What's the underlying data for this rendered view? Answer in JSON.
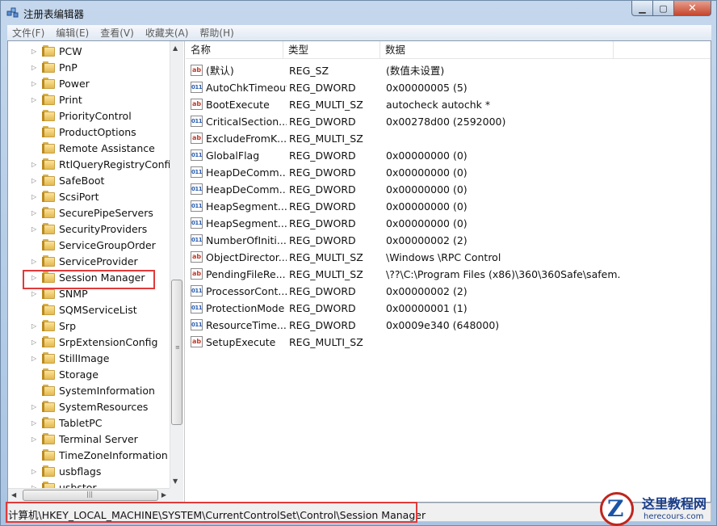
{
  "window": {
    "title": "注册表编辑器"
  },
  "menu": [
    "文件(F)",
    "编辑(E)",
    "查看(V)",
    "收藏夹(A)",
    "帮助(H)"
  ],
  "tree": {
    "items": [
      {
        "label": "PCW",
        "expandable": true
      },
      {
        "label": "PnP",
        "expandable": true
      },
      {
        "label": "Power",
        "expandable": true
      },
      {
        "label": "Print",
        "expandable": true
      },
      {
        "label": "PriorityControl",
        "expandable": false
      },
      {
        "label": "ProductOptions",
        "expandable": false
      },
      {
        "label": "Remote Assistance",
        "expandable": false
      },
      {
        "label": "RtlQueryRegistryConfig",
        "expandable": true
      },
      {
        "label": "SafeBoot",
        "expandable": true
      },
      {
        "label": "ScsiPort",
        "expandable": true
      },
      {
        "label": "SecurePipeServers",
        "expandable": true
      },
      {
        "label": "SecurityProviders",
        "expandable": true
      },
      {
        "label": "ServiceGroupOrder",
        "expandable": false
      },
      {
        "label": "ServiceProvider",
        "expandable": true
      },
      {
        "label": "Session Manager",
        "expandable": true,
        "selected": true
      },
      {
        "label": "SNMP",
        "expandable": true
      },
      {
        "label": "SQMServiceList",
        "expandable": false
      },
      {
        "label": "Srp",
        "expandable": true
      },
      {
        "label": "SrpExtensionConfig",
        "expandable": true
      },
      {
        "label": "StillImage",
        "expandable": true
      },
      {
        "label": "Storage",
        "expandable": false
      },
      {
        "label": "SystemInformation",
        "expandable": false
      },
      {
        "label": "SystemResources",
        "expandable": true
      },
      {
        "label": "TabletPC",
        "expandable": true
      },
      {
        "label": "Terminal Server",
        "expandable": true
      },
      {
        "label": "TimeZoneInformation",
        "expandable": false
      },
      {
        "label": "usbflags",
        "expandable": true
      },
      {
        "label": "usbstor",
        "expandable": true
      }
    ]
  },
  "list": {
    "headers": [
      "名称",
      "类型",
      "数据"
    ],
    "rows": [
      {
        "icon": "ab",
        "name": "(默认)",
        "type": "REG_SZ",
        "data": "(数值未设置)"
      },
      {
        "icon": "bin",
        "name": "AutoChkTimeout",
        "type": "REG_DWORD",
        "data": "0x00000005 (5)"
      },
      {
        "icon": "ab",
        "name": "BootExecute",
        "type": "REG_MULTI_SZ",
        "data": "autocheck autochk *"
      },
      {
        "icon": "bin",
        "name": "CriticalSection...",
        "type": "REG_DWORD",
        "data": "0x00278d00 (2592000)"
      },
      {
        "icon": "ab",
        "name": "ExcludeFromK...",
        "type": "REG_MULTI_SZ",
        "data": ""
      },
      {
        "icon": "bin",
        "name": "GlobalFlag",
        "type": "REG_DWORD",
        "data": "0x00000000 (0)"
      },
      {
        "icon": "bin",
        "name": "HeapDeComm...",
        "type": "REG_DWORD",
        "data": "0x00000000 (0)"
      },
      {
        "icon": "bin",
        "name": "HeapDeComm...",
        "type": "REG_DWORD",
        "data": "0x00000000 (0)"
      },
      {
        "icon": "bin",
        "name": "HeapSegment...",
        "type": "REG_DWORD",
        "data": "0x00000000 (0)"
      },
      {
        "icon": "bin",
        "name": "HeapSegment...",
        "type": "REG_DWORD",
        "data": "0x00000000 (0)"
      },
      {
        "icon": "bin",
        "name": "NumberOfIniti...",
        "type": "REG_DWORD",
        "data": "0x00000002 (2)"
      },
      {
        "icon": "ab",
        "name": "ObjectDirector...",
        "type": "REG_MULTI_SZ",
        "data": "\\Windows \\RPC Control"
      },
      {
        "icon": "ab",
        "name": "PendingFileRe...",
        "type": "REG_MULTI_SZ",
        "data": "\\??\\C:\\Program Files (x86)\\360\\360Safe\\safem..."
      },
      {
        "icon": "bin",
        "name": "ProcessorCont...",
        "type": "REG_DWORD",
        "data": "0x00000002 (2)"
      },
      {
        "icon": "bin",
        "name": "ProtectionMode",
        "type": "REG_DWORD",
        "data": "0x00000001 (1)"
      },
      {
        "icon": "bin",
        "name": "ResourceTime...",
        "type": "REG_DWORD",
        "data": "0x0009e340 (648000)"
      },
      {
        "icon": "ab",
        "name": "SetupExecute",
        "type": "REG_MULTI_SZ",
        "data": ""
      }
    ]
  },
  "status": {
    "path": "计算机\\HKEY_LOCAL_MACHINE\\SYSTEM\\CurrentControlSet\\Control\\Session Manager"
  },
  "watermark": {
    "title": "这里教程网",
    "url": "herecours.com"
  },
  "colors": {
    "highlight": "#e03a3a",
    "folder": "#e4b94f"
  }
}
